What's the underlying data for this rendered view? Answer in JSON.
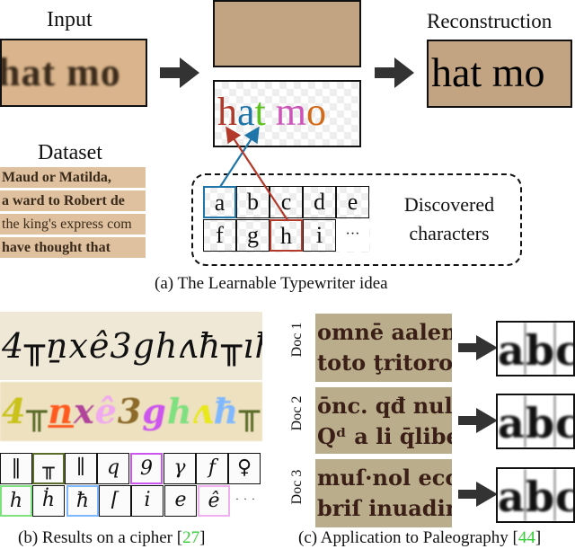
{
  "panel_a": {
    "input_label": "Input",
    "input_text": "hat mo",
    "reconstruction_label": "Reconstruction",
    "reconstruction_text": "hat mo",
    "colored_chars": [
      {
        "char": "h",
        "color": "#b33a2a"
      },
      {
        "char": "a",
        "color": "#1f74a8"
      },
      {
        "char": "t",
        "color": "#5cc21f"
      },
      {
        "char": " ",
        "color": "#000000"
      },
      {
        "char": "m",
        "color": "#cc55b8"
      },
      {
        "char": "o",
        "color": "#d46a17"
      }
    ],
    "dataset_label": "Dataset",
    "dataset_lines": [
      "Maud or Matilda,",
      "a ward to Robert de",
      "the king's express com",
      "have thought that"
    ],
    "discovered_grid_row1": [
      "a",
      "b",
      "c",
      "d",
      "e"
    ],
    "discovered_grid_row2": [
      "f",
      "g",
      "h",
      "i",
      "···"
    ],
    "discovered_label_line1": "Discovered",
    "discovered_label_line2": "characters",
    "caption": "(a) The Learnable Typewriter idea",
    "colors": {
      "blue_link": "#1f74a8",
      "red_link": "#b33a2a",
      "background": "#c2a382"
    }
  },
  "panel_b": {
    "cipher_original": "4╥ṉxê3ghʌħ╥ıħ",
    "cipher_reconstruction": [
      {
        "char": "4",
        "color": "#c9c21a"
      },
      {
        "char": "╥",
        "color": "#5a6a28"
      },
      {
        "char": "n",
        "color": "#ff5a1f"
      },
      {
        "char": "x",
        "color": "#b0449a"
      },
      {
        "char": "ê",
        "color": "#f0a8f0"
      },
      {
        "char": "3",
        "color": "#8c6a2a"
      },
      {
        "char": "g",
        "color": "#cc55ee"
      },
      {
        "char": "h",
        "color": "#7fe07f"
      },
      {
        "char": "ʌ",
        "color": "#e8e81a"
      },
      {
        "char": "ħ",
        "color": "#80b8ff"
      },
      {
        "char": "╥",
        "color": "#5a6a28"
      },
      {
        "char": "ı",
        "color": "#7a5a4a"
      },
      {
        "char": "ħ",
        "color": "#80b8ff"
      }
    ],
    "prototypes_row1": [
      {
        "char": "‖",
        "highlight": ""
      },
      {
        "char": "╥",
        "highlight": "#5a6a28"
      },
      {
        "char": "∥",
        "highlight": ""
      },
      {
        "char": "q",
        "highlight": ""
      },
      {
        "char": "9",
        "highlight": "#cc55ee"
      },
      {
        "char": "γ",
        "highlight": ""
      },
      {
        "char": "f",
        "highlight": ""
      },
      {
        "char": "♀",
        "highlight": ""
      }
    ],
    "prototypes_row2": [
      {
        "char": "h",
        "highlight": "#7fe07f"
      },
      {
        "char": "ḣ",
        "highlight": ""
      },
      {
        "char": "ħ",
        "highlight": "#80b8ff"
      },
      {
        "char": "⌈",
        "highlight": ""
      },
      {
        "char": "i",
        "highlight": ""
      },
      {
        "char": "e",
        "highlight": ""
      },
      {
        "char": "ê",
        "highlight": "#f0b0f0"
      }
    ],
    "ellipsis": "· · ·",
    "caption_prefix": "(b) Results on a cipher [",
    "caption_ref": "27",
    "caption_suffix": "]"
  },
  "panel_c": {
    "docs": [
      {
        "label": "Doc 1",
        "lines": [
          "omnē aalenu",
          "toto ţritoro d"
        ],
        "glyphs": [
          "a",
          "b",
          "c"
        ]
      },
      {
        "label": "Doc 2",
        "lines": [
          "ōnc. qđ nulli",
          "Qᵈ a li q̄liber c"
        ],
        "glyphs": [
          "a",
          "b",
          "c"
        ]
      },
      {
        "label": "Doc 3",
        "lines": [
          "muſ·nol ecclie",
          "briſ inuadim"
        ],
        "glyphs": [
          "a",
          "b",
          "c"
        ]
      }
    ],
    "caption_prefix": "(c) Application to Paleography [",
    "caption_ref": "44",
    "caption_suffix": "]"
  }
}
